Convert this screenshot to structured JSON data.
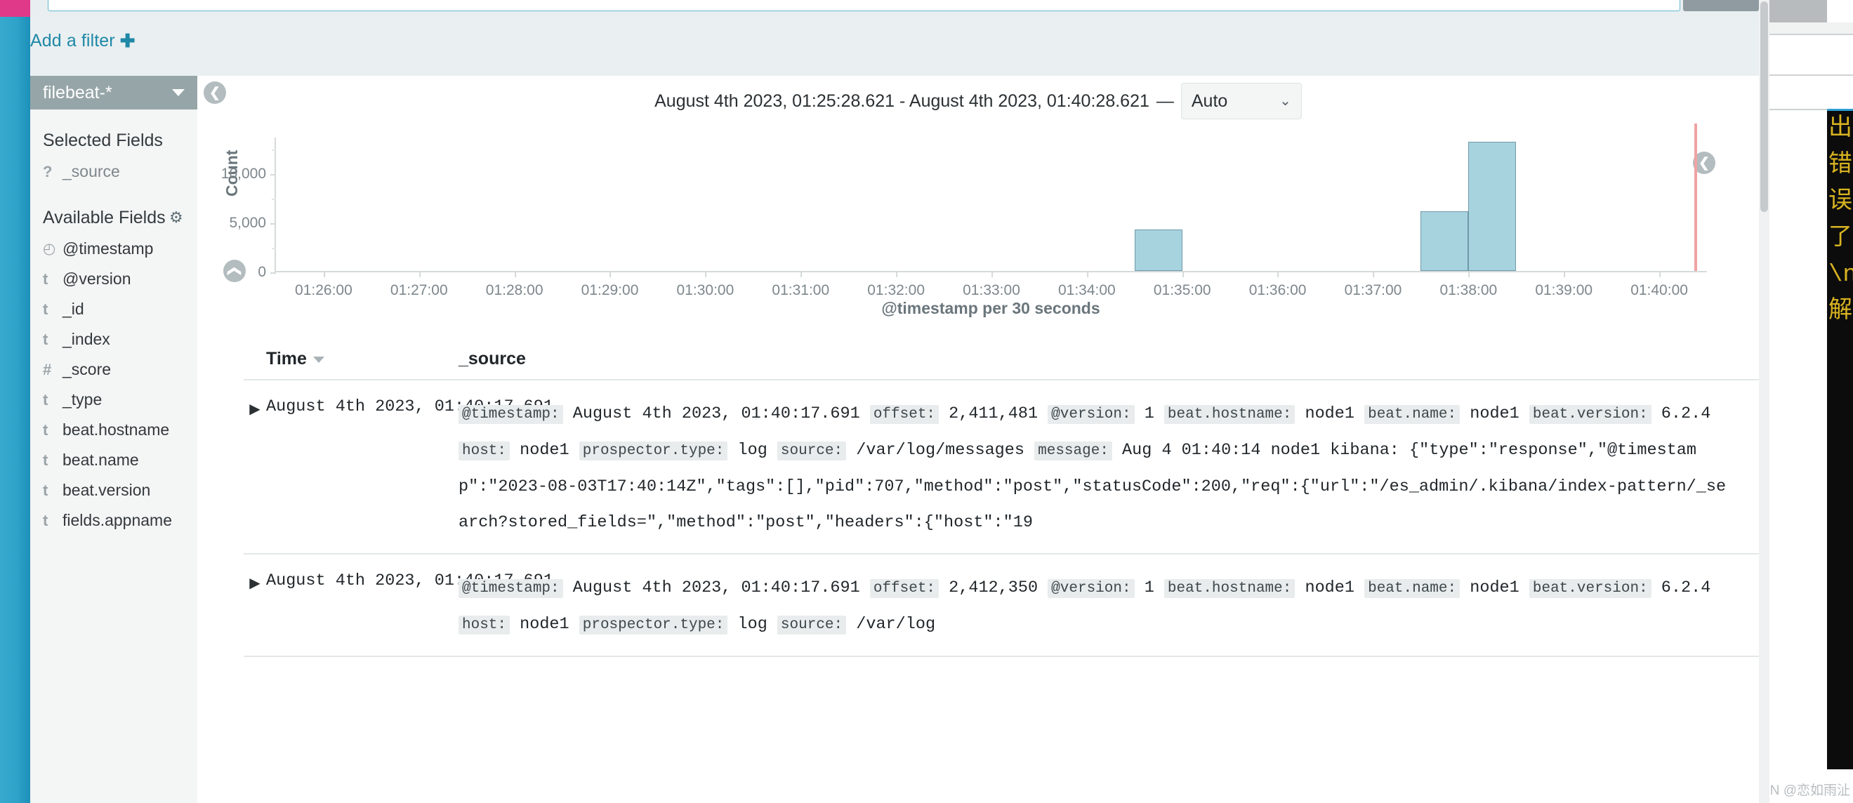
{
  "topbar": {
    "search_placeholder": "",
    "search_value": "",
    "search_button_label": ""
  },
  "filter_bar": {
    "add_filter_label": "Add a filter",
    "add_filter_icon": "plus-icon",
    "plus_glyph": "✚"
  },
  "sidebar": {
    "index_pattern": {
      "value": "filebeat-*",
      "icon": "chevron-down-icon"
    },
    "selected_fields": {
      "title": "Selected Fields",
      "items": [
        {
          "type": "?",
          "name": "_source",
          "icon": "unknown-type-icon"
        }
      ]
    },
    "available_fields": {
      "title": "Available Fields",
      "settings_icon": "gear-icon",
      "gear_glyph": "⚙",
      "items": [
        {
          "type": "◴",
          "name": "@timestamp",
          "icon": "clock-type-icon"
        },
        {
          "type": "t",
          "name": "@version",
          "icon": "string-type-icon"
        },
        {
          "type": "t",
          "name": "_id",
          "icon": "string-type-icon"
        },
        {
          "type": "t",
          "name": "_index",
          "icon": "string-type-icon"
        },
        {
          "type": "#",
          "name": "_score",
          "icon": "number-type-icon"
        },
        {
          "type": "t",
          "name": "_type",
          "icon": "string-type-icon"
        },
        {
          "type": "t",
          "name": "beat.hostname",
          "icon": "string-type-icon"
        },
        {
          "type": "t",
          "name": "beat.name",
          "icon": "string-type-icon"
        },
        {
          "type": "t",
          "name": "beat.version",
          "icon": "string-type-icon"
        },
        {
          "type": "t",
          "name": "fields.appname",
          "icon": "string-type-icon"
        }
      ]
    }
  },
  "time_header": {
    "range_text": "August 4th 2023, 01:25:28.621 - August 4th 2023, 01:40:28.621",
    "dash": "—",
    "interval_value": "Auto",
    "interval_icon": "chevron-down-icon",
    "chev_glyph": "⌄"
  },
  "controls": {
    "collapse_left_icon": "chevron-left-icon",
    "collapse_right_icon": "chevron-left-icon",
    "collapse_bottom_icon": "chevron-up-icon",
    "chevron_left_glyph": "❮",
    "chevron_up_glyph": "❮"
  },
  "chart_data": {
    "type": "bar",
    "title": "",
    "xlabel": "@timestamp per 30 seconds",
    "ylabel": "Count",
    "ylim": [
      0,
      13750
    ],
    "yticks": [
      0,
      5000,
      10000
    ],
    "ytick_labels": [
      "0",
      "5,000",
      "10,000"
    ],
    "grid": false,
    "legend": false,
    "xtick_labels": [
      "01:26:00",
      "01:27:00",
      "01:28:00",
      "01:29:00",
      "01:30:00",
      "01:31:00",
      "01:32:00",
      "01:33:00",
      "01:34:00",
      "01:35:00",
      "01:36:00",
      "01:37:00",
      "01:38:00",
      "01:39:00",
      "01:40:00"
    ],
    "bar_color": "#a7d3df",
    "bar_border_color": "#6f98a8",
    "marker_color": "#f0a3a3",
    "marker_label": "01:40:28",
    "categories": [
      "01:25:30",
      "01:26:00",
      "01:26:30",
      "01:27:00",
      "01:27:30",
      "01:28:00",
      "01:28:30",
      "01:29:00",
      "01:29:30",
      "01:30:00",
      "01:30:30",
      "01:31:00",
      "01:31:30",
      "01:32:00",
      "01:32:30",
      "01:33:00",
      "01:33:30",
      "01:34:00",
      "01:34:30",
      "01:35:00",
      "01:35:30",
      "01:36:00",
      "01:36:30",
      "01:37:00",
      "01:37:30",
      "01:38:00",
      "01:38:30",
      "01:39:00",
      "01:39:30",
      "01:40:00"
    ],
    "values": [
      0,
      0,
      0,
      0,
      0,
      0,
      0,
      0,
      0,
      0,
      0,
      0,
      0,
      0,
      0,
      0,
      0,
      0,
      4200,
      0,
      0,
      0,
      0,
      0,
      6100,
      13200,
      0,
      0,
      0,
      0
    ]
  },
  "doc_table": {
    "columns": {
      "time": "Time",
      "source": "_source",
      "sort_icon": "sort-desc-icon",
      "expand_icon": "expand-row-icon",
      "expand_glyph": "▶"
    },
    "rows": [
      {
        "time": "August 4th 2023, 01:40:17.691",
        "source_parts": [
          {
            "kind": "key",
            "text": "@timestamp:"
          },
          {
            "kind": "val",
            "text": "August 4th 2023, 01:40:17.691"
          },
          {
            "kind": "key",
            "text": "offset:"
          },
          {
            "kind": "val",
            "text": "2,411,481"
          },
          {
            "kind": "key",
            "text": "@version:"
          },
          {
            "kind": "val",
            "text": "1"
          },
          {
            "kind": "key",
            "text": "beat.hostname:"
          },
          {
            "kind": "val",
            "text": "node1"
          },
          {
            "kind": "key",
            "text": "beat.name:"
          },
          {
            "kind": "val",
            "text": "node1"
          },
          {
            "kind": "key",
            "text": "beat.version:"
          },
          {
            "kind": "val",
            "text": "6.2.4"
          },
          {
            "kind": "key",
            "text": "host:"
          },
          {
            "kind": "val",
            "text": "node1"
          },
          {
            "kind": "key",
            "text": "prospector.type:"
          },
          {
            "kind": "val",
            "text": "log"
          },
          {
            "kind": "key",
            "text": "source:"
          },
          {
            "kind": "val",
            "text": "/var/log/messages"
          },
          {
            "kind": "key",
            "text": "message:"
          },
          {
            "kind": "val",
            "text": "Aug 4 01:40:14 node1 kibana: {\"type\":\"response\",\"@timestamp\":\"2023-08-03T17:40:14Z\",\"tags\":[],\"pid\":707,\"method\":\"post\",\"statusCode\":200,\"req\":{\"url\":\"/es_admin/.kibana/index-pattern/_search?stored_fields=\",\"method\":\"post\",\"headers\":{\"host\":\"19"
          }
        ]
      },
      {
        "time": "August 4th 2023, 01:40:17.691",
        "source_parts": [
          {
            "kind": "key",
            "text": "@timestamp:"
          },
          {
            "kind": "val",
            "text": "August 4th 2023, 01:40:17.691"
          },
          {
            "kind": "key",
            "text": "offset:"
          },
          {
            "kind": "val",
            "text": "2,412,350"
          },
          {
            "kind": "key",
            "text": "@version:"
          },
          {
            "kind": "val",
            "text": "1"
          },
          {
            "kind": "key",
            "text": "beat.hostname:"
          },
          {
            "kind": "val",
            "text": "node1"
          },
          {
            "kind": "key",
            "text": "beat.name:"
          },
          {
            "kind": "val",
            "text": "node1"
          },
          {
            "kind": "key",
            "text": "beat.version:"
          },
          {
            "kind": "val",
            "text": "6.2.4"
          },
          {
            "kind": "key",
            "text": "host:"
          },
          {
            "kind": "val",
            "text": "node1"
          },
          {
            "kind": "key",
            "text": "prospector.type:"
          },
          {
            "kind": "val",
            "text": "log"
          },
          {
            "kind": "key",
            "text": "source:"
          },
          {
            "kind": "val",
            "text": "/var/log"
          }
        ]
      }
    ]
  },
  "right_panel": {
    "editor_text": "出错误了，\\n解",
    "watermark": "N @恋如雨沚"
  },
  "colors": {
    "accent_blue": "#1f88a7",
    "rail_blue": "#2fa3c9",
    "rail_pink": "#e0398a",
    "index_select_bg": "#96a5a8",
    "bar_fill": "#a7d3df",
    "bar_stroke": "#6f98a8",
    "marker_red": "#f0a3a3"
  }
}
